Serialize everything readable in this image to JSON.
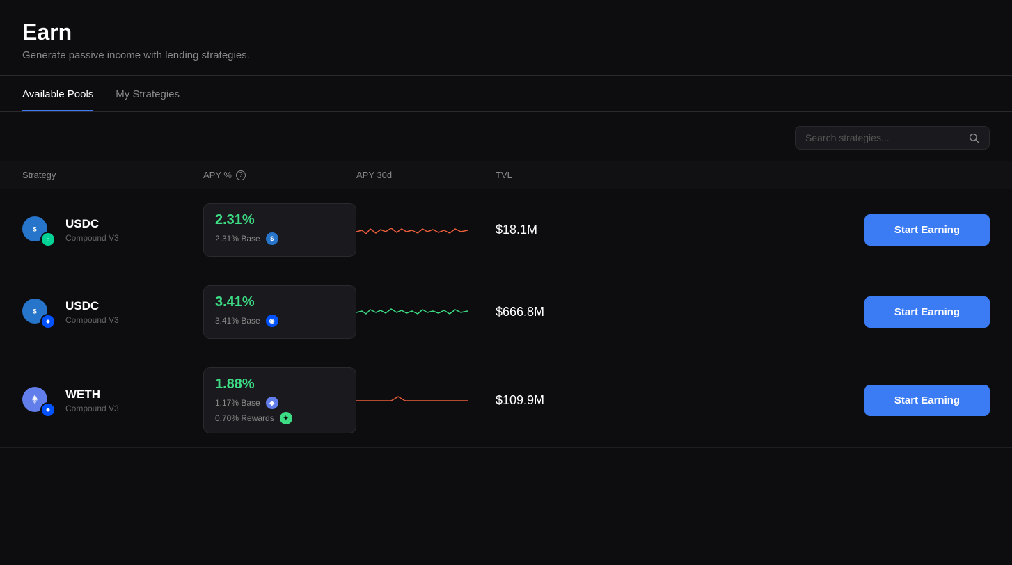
{
  "header": {
    "title": "Earn",
    "subtitle": "Generate passive income with lending strategies."
  },
  "tabs": [
    {
      "id": "available-pools",
      "label": "Available Pools",
      "active": true
    },
    {
      "id": "my-strategies",
      "label": "My Strategies",
      "active": false
    }
  ],
  "search": {
    "placeholder": "Search strategies..."
  },
  "table": {
    "columns": [
      {
        "id": "strategy",
        "label": "Strategy"
      },
      {
        "id": "apy",
        "label": "APY %"
      },
      {
        "id": "apy30d",
        "label": "APY 30d"
      },
      {
        "id": "tvl",
        "label": "TVL"
      }
    ],
    "rows": [
      {
        "id": "usdc-compound-v3-1",
        "name": "USDC",
        "protocol": "Compound V3",
        "apy": "2.31%",
        "apy_base": "2.31% Base",
        "apy30d_sparkline": "orange",
        "tvl": "$18.1M",
        "action_label": "Start Earning",
        "token_color": "usdc",
        "badge_color": "compound"
      },
      {
        "id": "usdc-compound-v3-2",
        "name": "USDC",
        "protocol": "Compound V3",
        "apy": "3.41%",
        "apy_base": "3.41% Base",
        "apy30d_sparkline": "green",
        "tvl": "$666.8M",
        "action_label": "Start Earning",
        "token_color": "usdc",
        "badge_color": "base"
      },
      {
        "id": "weth-compound-v3",
        "name": "WETH",
        "protocol": "Compound V3",
        "apy": "1.88%",
        "apy_base": "1.17% Base",
        "apy_rewards": "0.70% Rewards",
        "apy30d_sparkline": "orange",
        "tvl": "$109.9M",
        "action_label": "Start Earning",
        "token_color": "weth",
        "badge_color": "base"
      }
    ]
  },
  "icons": {
    "search": "🔍",
    "info": "ℹ"
  }
}
